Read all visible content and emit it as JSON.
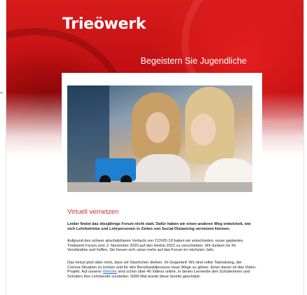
{
  "header": {
    "logo_text": "Trieöwerk",
    "tagline": "Begeistern Sie Jugendliche"
  },
  "article": {
    "photo_alt": "Zwei Mädchen arbeiten an einem kleinen Roboter",
    "section_title": "Virtuell vernetzen",
    "intro_bold": "Leider findet das diesjährige Forum nicht statt. Dafür haben wir einen anderen Weg entwickelt, wie sich Lehrbetriebe und Lehrpersonen in Zeiten von Social Distancing vernetzen können.",
    "paragraph_2": "Aufgrund des schwer abschätzbaren Verlaufs von COVID-19 haben wir entschieden, unser geplantes Triebwerk Forum vom 2. November 2020 auf den Herbst 2021 zu verschieben. Wir danken für Ihr Verständnis und hoffen, Sie freuen sich umso mehr auf das Forum im nächsten Jahr.",
    "paragraph_3_before_link": "Das heisst jetzt aber nicht, dass wir Däumchen drehen. Im Gegenteil: Wir sind voller Tatendrang, der Corona-Situation zu trotzen und für den Berufswahlprozess neue Wege zu gehen. Einer davon ist das Video-Projekt. Auf unserer ",
    "paragraph_3_link": "Website",
    "paragraph_3_after_link": " sind schon über 40 Videos online, in denen Lernende den Schülerinnen und Schülern ihre Lehrberufe vorstellen. 5000 Mal wurde diese bereits geschätzt."
  },
  "colors": {
    "brand_red": "#c10f12",
    "title_red": "#d42a2a",
    "link_blue": "#1a6fd6"
  }
}
